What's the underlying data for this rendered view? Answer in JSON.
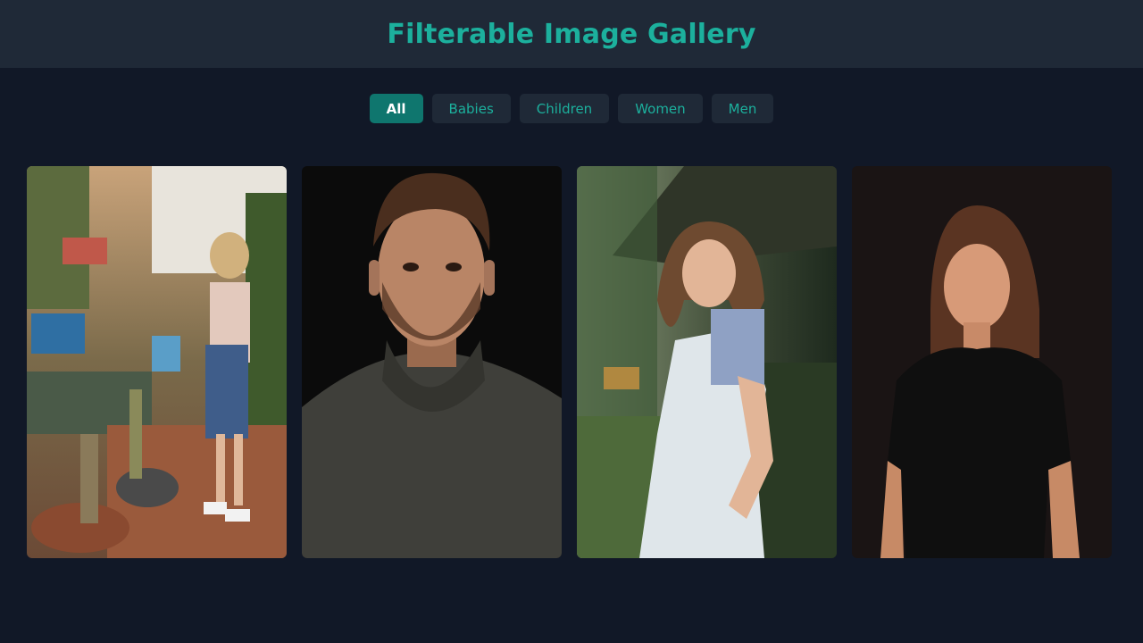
{
  "header": {
    "title": "Filterable Image Gallery"
  },
  "filters": [
    {
      "label": "All",
      "active": true
    },
    {
      "label": "Babies",
      "active": false
    },
    {
      "label": "Children",
      "active": false
    },
    {
      "label": "Women",
      "active": false
    },
    {
      "label": "Men",
      "active": false
    }
  ],
  "colors": {
    "background": "#111827",
    "header": "#1f2937",
    "accent": "#1cb09d",
    "active_filter": "#0f766e"
  }
}
